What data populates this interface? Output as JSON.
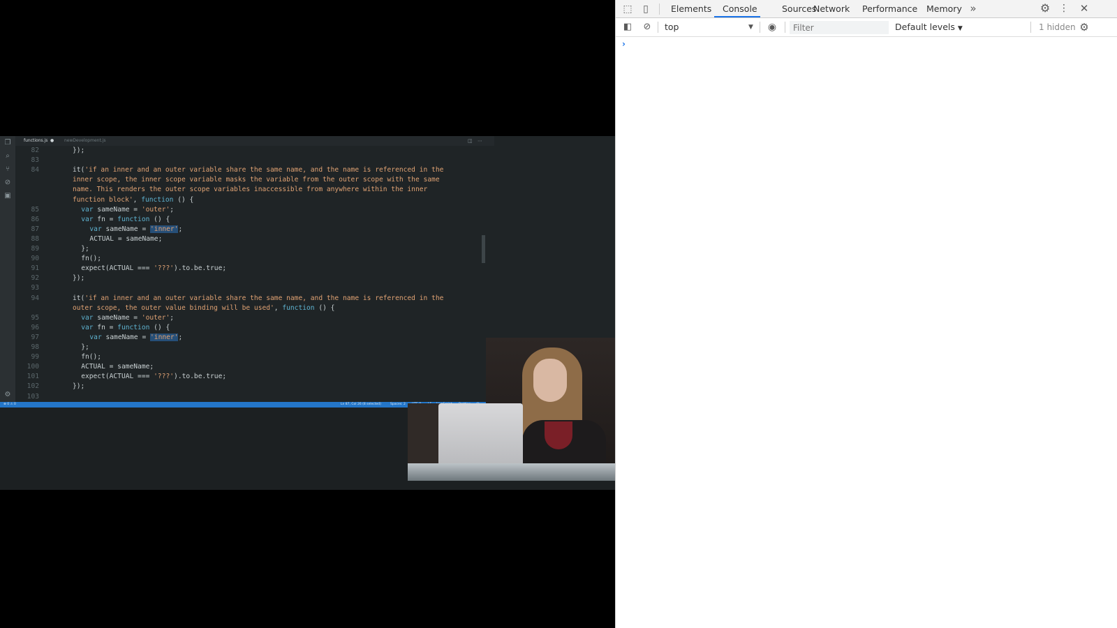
{
  "devtools": {
    "tabs": [
      {
        "label": "Elements"
      },
      {
        "label": "Console"
      },
      {
        "label": "Sources"
      },
      {
        "label": "Network"
      },
      {
        "label": "Performance"
      },
      {
        "label": "Memory"
      }
    ],
    "active_tab": "Console",
    "more_tabs_glyph": "»",
    "console": {
      "context": "top",
      "filter_placeholder": "Filter",
      "levels": "Default levels",
      "hidden": "1 hidden",
      "prompt": "›"
    }
  },
  "editor": {
    "tabs": [
      {
        "label": "functions.js"
      },
      {
        "label": "newDevelopment.js"
      }
    ],
    "lines": [
      {
        "num": "82",
        "text": "});"
      },
      {
        "num": "83",
        "text": ""
      },
      {
        "num": "84",
        "text": "it('if an inner and an outer variable share the same name, and the name is referenced in the"
      },
      {
        "num": "",
        "text": "inner scope, the inner scope variable masks the variable from the outer scope with the same"
      },
      {
        "num": "",
        "text": "name. This renders the outer scope variables inaccessible from anywhere within the inner"
      },
      {
        "num": "",
        "text": "function block', function () {"
      },
      {
        "num": "85",
        "text": "var sameName = 'outer';"
      },
      {
        "num": "86",
        "text": "var fn = function () {"
      },
      {
        "num": "87",
        "text": "var sameName = 'inner';"
      },
      {
        "num": "88",
        "text": "ACTUAL = sameName;"
      },
      {
        "num": "89",
        "text": "};"
      },
      {
        "num": "90",
        "text": "fn();"
      },
      {
        "num": "91",
        "text": "expect(ACTUAL === '???').to.be.true;"
      },
      {
        "num": "92",
        "text": "});"
      },
      {
        "num": "93",
        "text": ""
      },
      {
        "num": "94",
        "text": "it('if an inner and an outer variable share the same name, and the name is referenced in the"
      },
      {
        "num": "",
        "text": "outer scope, the outer value binding will be used', function () {"
      },
      {
        "num": "95",
        "text": "var sameName = 'outer';"
      },
      {
        "num": "96",
        "text": "var fn = function () {"
      },
      {
        "num": "97",
        "text": "var sameName = 'inner';"
      },
      {
        "num": "98",
        "text": "};"
      },
      {
        "num": "99",
        "text": "fn();"
      },
      {
        "num": "100",
        "text": "ACTUAL = sameName;"
      },
      {
        "num": "101",
        "text": "expect(ACTUAL === '???').to.be.true;"
      },
      {
        "num": "102",
        "text": "});"
      },
      {
        "num": "103",
        "text": ""
      }
    ],
    "status_bar": {
      "position": "Ln 87, Col 26 (8 selected)",
      "spaces": "Spaces: 2",
      "encoding": "UTF-8",
      "eol": "LF",
      "language": "JavaScript",
      "formatter": "Prettier"
    }
  },
  "colors": {
    "devtools_accent": "#1a73e8",
    "status_bar": "#2476c8",
    "editor_bg": "#1f2426"
  }
}
